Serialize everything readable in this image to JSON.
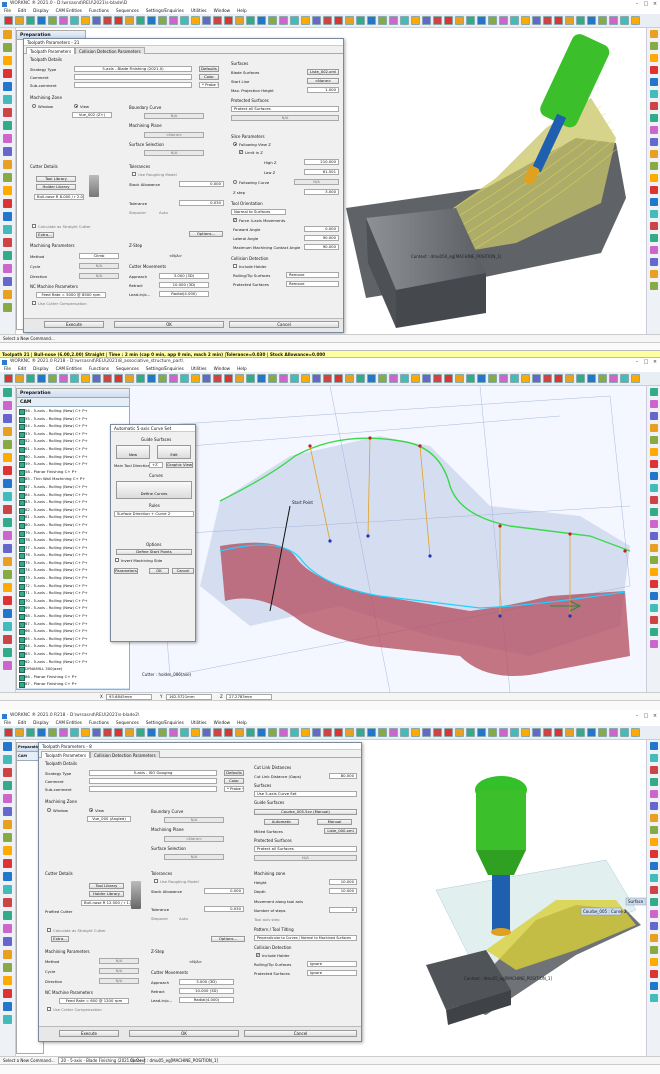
{
  "shot1": {
    "title": "WORKNC ® 2021.0 - D:\\wrsasnd\\REU\\2021\\s-blade\\D",
    "menu": [
      "File",
      "Edit",
      "Display",
      "CAM Entities",
      "Functions",
      "Sequences",
      "Settings/Enquiries",
      "Utilities",
      "Window",
      "Help"
    ],
    "panel_title": "Preparation",
    "dialog": {
      "title": "Toolpath Parameters - 21",
      "tabs": [
        "Toolpath Parameters",
        "Collision Detection Parameters"
      ],
      "toolpath_details": "Toolpath Details",
      "strategy_label": "Strategy Type",
      "strategy_value": "5-axis - Blade Finishing (2021.0)",
      "defaults": "Defaults",
      "comment_label": "Comment",
      "color_btn": "Color",
      "subcomment_label": "Sub-comment",
      "probe": "* Probe *",
      "machining_zone": "Machining Zone",
      "window": "Window",
      "view": "View",
      "view_value": "Vue_002 (Z+)",
      "boundary_curve": "Boundary Curve",
      "na": "N/A",
      "machining_plane": "Machining Plane",
      "none": "<None>",
      "surface_selection": "Surface Selection",
      "cutter_details": "Cutter Details",
      "tool_library": "Tool Library",
      "holder_library": "Holder Library",
      "cutter_value": "Bull-nose R 8.000 / r 2.000",
      "calc_straight": "Calculate as Straight Cutter",
      "extra": "Extra...",
      "tolerances": "Tolerances",
      "use_roughing": "Use Roughing Model",
      "stock_allowance": "Stock Allowance",
      "stock_value": "0.000",
      "tolerance": "Tolerance",
      "tolerance_value": "0.030",
      "stepover": "Stepover",
      "auto": "Auto",
      "options": "Options...",
      "machining_params": "Machining Parameters",
      "method": "Method",
      "method_value": "Climb",
      "cycle": "Cycle",
      "direction": "Direction",
      "nc_params": "NC Machine Parameters",
      "feed": "Feed Rate = 5000 @ 8500 rpm",
      "use_cutter_comp": "Use Cutter Compensation",
      "zstep": "Z-Step",
      "na2": "<N/A>",
      "cutter_movements": "Cutter Movements",
      "approach": "Approach",
      "approach_value": "3.000 (3D)",
      "retract": "Retract",
      "retract_value": "10.000 (3D)",
      "leadin": "Lead-in/o...",
      "leadin_value": "Radial(4.000)",
      "surfaces": "Surfaces",
      "blade_surfaces": "Blade Surfaces",
      "blade_value": "Liste_002.xml",
      "start_line": "Start Line",
      "start_line_value": "<None>",
      "max_proj": "Max. Projection Height",
      "max_proj_value": "1.000",
      "protected_surfaces": "Protected Surfaces",
      "protect_all": "Protect all Surfaces",
      "slice_params": "Slice Parameters",
      "following_view": "Following View Z",
      "limit_z": "Limit in Z",
      "high_z": "High Z",
      "high_z_value": "210.000",
      "low_z": "Low Z",
      "low_z_value": "61.501",
      "following_curve": "Following Curve",
      "z_step": "Z step",
      "z_step_value": "3.000",
      "tool_orientation": "Tool Orientation",
      "normal_surfaces": "Normal to Surfaces",
      "force_4axis": "Force 4-axis Movements",
      "forward_angle": "Forward Angle",
      "forward_value": "0.000",
      "lateral_angle": "Lateral Angle",
      "lateral_value": "90.000",
      "max_contact": "Maximum Machining Contact Angle",
      "max_contact_value": "90.000",
      "collision_detection": "Collision Detection",
      "include_holder": "Include Holder",
      "rolling_tip": "Rolling/Tip Surfaces",
      "remove": "Remove",
      "protected_surf2": "Protected Surfaces",
      "remove2": "Remove",
      "execute": "Execute",
      "ok": "OK",
      "cancel": "Cancel"
    },
    "status": "Select a New Command...",
    "context": "Context : dmu050_eg[MACHINE_POSITION_1]"
  },
  "infobar": "Toolpath 21 | Bull-nose (6.00,2.00) Straight | Time : 2 min (cap 0 min, app 0 min, mach 2 min) |Tolerance=0.030 | Stock Allowance=0.000",
  "shot2": {
    "title": "WORKNC ® 2021.0 R218 - D:\\wrsasnd\\REU\\2021\\8_associative_structure_part\\",
    "menu": [
      "File",
      "Edit",
      "Display",
      "CAM Entities",
      "Functions",
      "Sequences",
      "Settings/Enquiries",
      "Utilities",
      "Window",
      "Help"
    ],
    "panel_title": "Preparation",
    "tree_head": "CAM",
    "tree": [
      "56 - 5-axis - Rolling (New)  C+  P+",
      "55 - 5-axis - Rolling (New)  C+  P+",
      "54 - 5-axis - Rolling (New)  C+  P+",
      "53 - 5-axis - Rolling (New)  C+  P+",
      "52 - 5-axis - Rolling (New)  C+  P+",
      "61 - 5-axis - Rolling (New)  C+  P+",
      "60 - 5-axis - Rolling (New)  C+  P+",
      "59 - 5-axis - Rolling (New)  C+  P+",
      "58 - Planar Finishing  C+  P+",
      "85 - Thin Wall Machining  C+  P+",
      "87 - 5-axis - Rolling (New)  C+  P+",
      "84 - 5-axis - Rolling (New)  C+  P+",
      "83 - 5-axis - Rolling (New)  C+  P+",
      "82 - 5-axis - Rolling (New)  C+  P+",
      "81 - 5-axis - Rolling (New)  C+  P+",
      "80 - 5-axis - Rolling (New)  C+  P+",
      "79 - 5-axis - Rolling (New)  C+  P+",
      "78 - 5-axis - Rolling (New)  C+  P+",
      "77 - 5-axis - Rolling (New)  C+  P+",
      "76 - 5-axis - Rolling (New)  C+  P+",
      "75 - 5-axis - Rolling (New)  C+  P+",
      "74 - 5-axis - Rolling (New)  C+  P+",
      "73 - 5-axis - Rolling (New)  C+  P+",
      "72 - 5-axis - Rolling (New)  C+  P+",
      "71 - 5-axis - Rolling (New)  C+  P+",
      "70 - 5-axis - Rolling (New)  C+  P+",
      "69 - 5-axis - Rolling (New)  C+  P+",
      "68 - 5-axis - Rolling (New)  C+  P+",
      "67 - 5-axis - Rolling (New)  C+  P+",
      "66 - 5-axis - Rolling (New)  C+  P+",
      "65 - 5-axis - Rolling (New)  C+  P+",
      "64 - 5-axis - Rolling (New)  C+  P+",
      "63 - 5-axis - Rolling (New)  C+  P+",
      "62 - 5-axis - Rolling (New)  C+  P+",
      "DYNAMILL 300(axe)",
      "86 - Planar Finishing  C+  P+",
      "87 - Planar Finishing  C+  P+",
      "holder_006(axe)",
      "89 - 5-axis - Rolling (New)  C+  P+"
    ],
    "dialog": {
      "title": "Automatic 5-axis Curve Set",
      "guide_surfaces": "Guide Surfaces",
      "new": "New",
      "edit": "Edit",
      "main_tool_dir": "Main Tool Direction",
      "mtd_value": "+Z",
      "graphic_view": "Graphic View",
      "curves": "Curves",
      "define_curves": "Define Curves",
      "rules": "Rules",
      "rules_value": "Surface Direction + Curve 2",
      "options": "Options",
      "define_start": "Define Start Points",
      "invert_side": "Invert Machining Side",
      "parameters": "Parameters",
      "ok": "OK",
      "cancel": "Cancel"
    },
    "label_start": "Start Point",
    "cutter_label": "Cutter : holder_006(axe)",
    "coords": {
      "x": "93.6845mm",
      "y": "162.5721mm",
      "z": "27.2783mm"
    }
  },
  "shot3": {
    "title": "WORKNC ® 2021.0 R218 - D:\\wrsasnd\\REU\\2021\\s-blade2\\",
    "menu": [
      "File",
      "Edit",
      "Display",
      "CAM Entities",
      "Functions",
      "Sequences",
      "Settings/Enquiries",
      "Utilities",
      "Window",
      "Help"
    ],
    "panel_title": "Preparation",
    "tree_head": "CAM",
    "dialog": {
      "title": "Toolpath Parameters - 8",
      "tabs": [
        "Toolpath Parameters",
        "Collision Detection Parameters"
      ],
      "toolpath_details": "Toolpath Details",
      "strategy_label": "Strategy Type",
      "strategy_value": "5-axis - ISO Gouging",
      "defaults": "Defaults",
      "comment_label": "Comment",
      "color_btn": "Color",
      "subcomment_label": "Sub-comment",
      "probe": "* Probe *",
      "machining_zone": "Machining Zone",
      "window": "Window",
      "view": "View",
      "view_value": "Vue_000 (Angled)",
      "boundary_curve": "Boundary Curve",
      "na": "N/A",
      "machining_plane": "Machining Plane",
      "none": "<None>",
      "surface_selection": "Surface Selection",
      "cutter_details": "Cutter Details",
      "tool_library": "Tool Library",
      "holder_library": "Holder Library",
      "cutter_value": "Bull-nose R 12.500 / r 1.212",
      "profiled": "Profiled Cutter",
      "calc_straight": "Calculate as Straight Cutter",
      "extra": "Extra...",
      "tolerances": "Tolerances",
      "use_roughing": "Use Roughing Model",
      "stock_allowance": "Stock Allowance",
      "stock_value": "0.000",
      "tolerance": "Tolerance",
      "tolerance_value": "0.030",
      "stepover": "Stepover",
      "auto": "Auto",
      "options": "Options...",
      "machining_params": "Machining Parameters",
      "method": "Method",
      "cycle": "Cycle",
      "direction": "Direction",
      "nc_params": "NC Machine Parameters",
      "feed": "Feed Rate = 600 @ 1200 rpm",
      "use_cutter_comp": "Use Cutter Compensation",
      "zstep": "Z-Step",
      "na2": "<N/A>",
      "cutter_movements": "Cutter Movements",
      "approach": "Approach",
      "approach_value": "3.000 (3D)",
      "retract": "Retract",
      "retract_value": "10.000 (3D)",
      "leadin": "Lead-in/o...",
      "leadin_value": "Radial(4.000)",
      "cut_link": "Cut Link Distances",
      "cut_link_label": "Cut Link Distance (Gaps)",
      "cut_link_value": "80.000",
      "surfaces": "Surfaces",
      "surfaces_value": "Use 5-axis Curve Set",
      "guide_surfaces": "Guide Surfaces",
      "guide_value": "Courbe_005.5cv (Manual)",
      "automatic": "Automatic",
      "manual": "Manual",
      "milled_surfaces": "Milled Surfaces",
      "milled_value": "Liste_000.xml",
      "protected_surfaces": "Protected Surfaces",
      "protect_all": "Protect all Surfaces",
      "machining_zone2": "Machining zone",
      "height": "Height",
      "height_value": "10.000",
      "depth": "Depth",
      "depth_value": "10.000",
      "movement_tool": "Movement along tool axis",
      "num_steps": "Number of steps",
      "num_steps_value": "0",
      "tool_axis_step": "Tool axis step",
      "pattern_tilt": "Pattern / Tool Tilting",
      "pattern_value": "Perpendicular to Curves / Normal to Machined Surfaces",
      "collision_detection": "Collision Detection",
      "include_holder": "Include Holder",
      "rolling_tip": "Rolling/Tip Surfaces",
      "ignore": "Ignore",
      "protected_surf2": "Protected Surfaces",
      "ignore2": "Ignore",
      "execute": "Execute",
      "ok": "OK",
      "cancel": "Cancel"
    },
    "curve_label": "Courbe_005 : Curve 2",
    "surface_label": "Surface",
    "status": "Select a New Command...",
    "context": "Context : dmu05_eg[MACHINE_POSITION_1]",
    "bottom_tree": "20 - 5-axis - Blade Finishing (2021.0)  C+"
  },
  "colors": {
    "accent": "#2a7fd0",
    "part_gray": "#6f7378",
    "toolpath_yellow": "#d8cf3a",
    "wall_red": "#b34a5a",
    "tool_green": "#3bbf2a",
    "tool_blue": "#1f5fb0",
    "infobar": "#ffffa0"
  }
}
